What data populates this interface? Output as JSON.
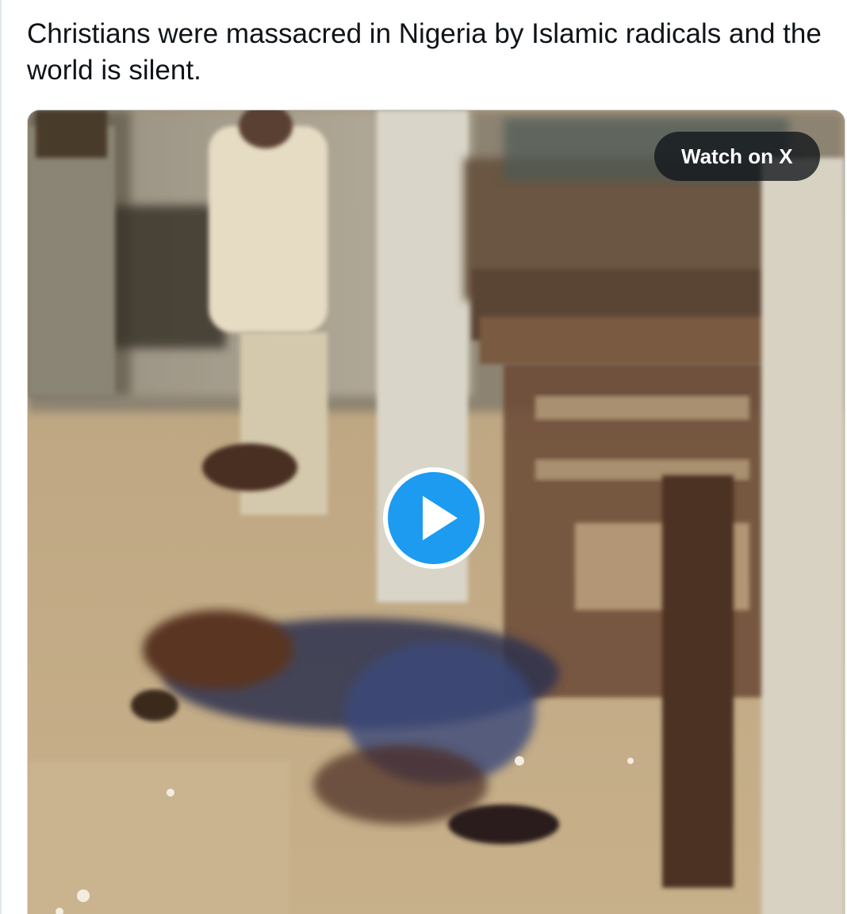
{
  "tweet": {
    "text": "Christians were massacred in Nigeria by Islamic radicals and the world is silent."
  },
  "video": {
    "watch_label": "Watch on X",
    "play_icon": "play-icon",
    "accent_color": "#1d9bf0"
  }
}
